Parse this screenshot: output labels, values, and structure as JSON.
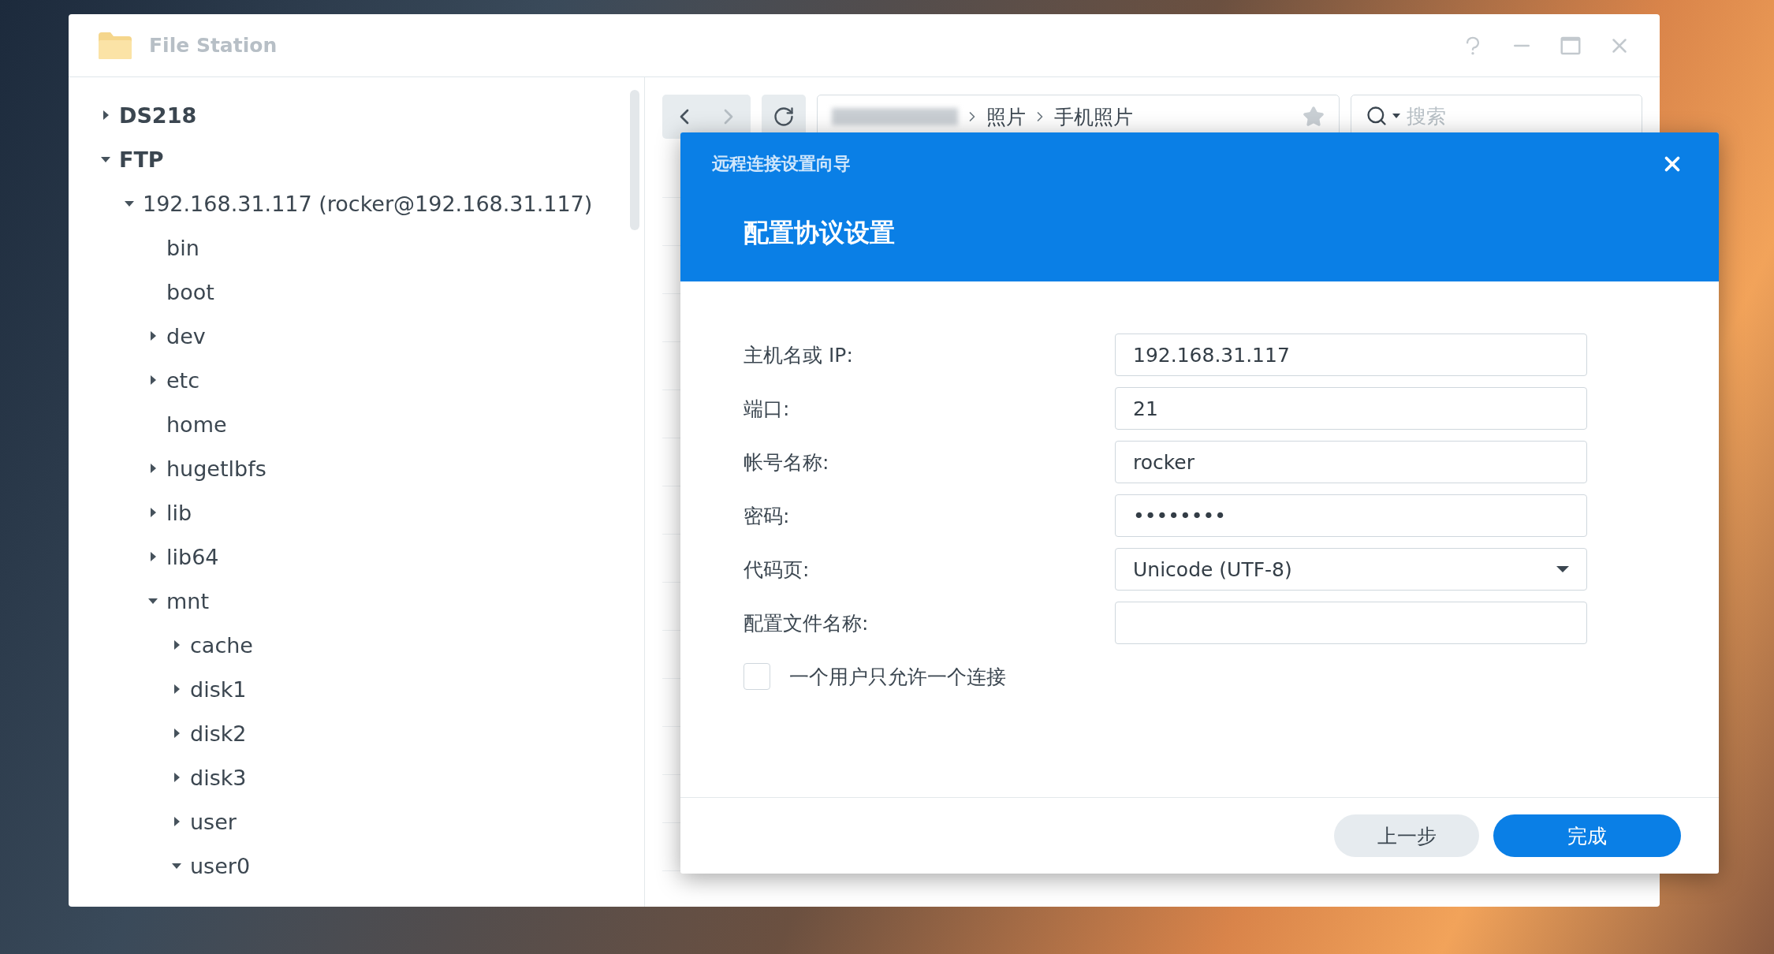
{
  "window": {
    "title": "File Station"
  },
  "sidebar": {
    "tree": [
      {
        "label": "DS218",
        "bold": true,
        "expanded": false
      },
      {
        "label": "FTP",
        "bold": true,
        "expanded": true,
        "children": [
          {
            "label": "192.168.31.117 (rocker@192.168.31.117)",
            "expanded": true,
            "children": [
              {
                "label": "bin"
              },
              {
                "label": "boot"
              },
              {
                "label": "dev",
                "expanded": false
              },
              {
                "label": "etc",
                "expanded": false
              },
              {
                "label": "home"
              },
              {
                "label": "hugetlbfs",
                "expanded": false
              },
              {
                "label": "lib",
                "expanded": false
              },
              {
                "label": "lib64",
                "expanded": false
              },
              {
                "label": "mnt",
                "expanded": true,
                "children": [
                  {
                    "label": "cache",
                    "expanded": false
                  },
                  {
                    "label": "disk1",
                    "expanded": false
                  },
                  {
                    "label": "disk2",
                    "expanded": false
                  },
                  {
                    "label": "disk3",
                    "expanded": false
                  },
                  {
                    "label": "user",
                    "expanded": false
                  },
                  {
                    "label": "user0",
                    "expanded": true
                  }
                ]
              }
            ]
          }
        ]
      }
    ]
  },
  "toolbar": {
    "path": [
      "照片",
      "手机照片"
    ],
    "search": {
      "placeholder": "搜索"
    }
  },
  "dialog": {
    "title": "远程连接设置向导",
    "heading": "配置协议设置",
    "fields": [
      {
        "kind": "text",
        "label": "主机名或 IP:",
        "value": "192.168.31.117"
      },
      {
        "kind": "text",
        "label": "端口:",
        "value": "21"
      },
      {
        "kind": "text",
        "label": "帐号名称:",
        "value": "rocker"
      },
      {
        "kind": "password",
        "label": "密码:",
        "value": "••••••••"
      },
      {
        "kind": "select",
        "label": "代码页:",
        "value": "Unicode (UTF-8)"
      },
      {
        "kind": "text",
        "label": "配置文件名称:"
      }
    ],
    "checkbox": {
      "label": "一个用户只允许一个连接",
      "checked": false
    },
    "buttons": [
      {
        "kind": "secondary",
        "label": "上一步"
      },
      {
        "kind": "primary",
        "label": "完成"
      }
    ]
  }
}
